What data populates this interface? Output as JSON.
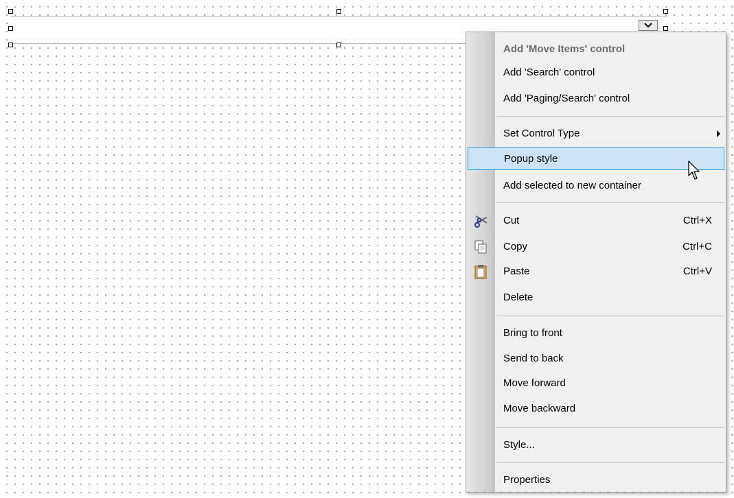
{
  "designer": {
    "control": "combobox"
  },
  "context_menu": {
    "items": [
      {
        "label": "Add 'Move Items' control",
        "enabled": false
      },
      {
        "label": "Add 'Search' control"
      },
      {
        "label": "Add 'Paging/Search' control"
      },
      {
        "label": "Set Control Type",
        "submenu": true
      },
      {
        "label": "Popup style",
        "highlighted": true
      },
      {
        "label": "Add selected to new container"
      },
      {
        "label": "Cut",
        "shortcut": "Ctrl+X",
        "icon": "scissors-icon"
      },
      {
        "label": "Copy",
        "shortcut": "Ctrl+C",
        "icon": "copy-icon"
      },
      {
        "label": "Paste",
        "shortcut": "Ctrl+V",
        "icon": "paste-icon"
      },
      {
        "label": "Delete"
      },
      {
        "label": "Bring to front"
      },
      {
        "label": "Send to back"
      },
      {
        "label": "Move forward"
      },
      {
        "label": "Move backward"
      },
      {
        "label": "Style..."
      },
      {
        "label": "Properties"
      }
    ]
  },
  "colors": {
    "highlight_bg": "#cce4f7",
    "highlight_border": "#26a0da",
    "menu_bg": "#f0f0f0",
    "disabled_text": "#6d6d6d"
  }
}
